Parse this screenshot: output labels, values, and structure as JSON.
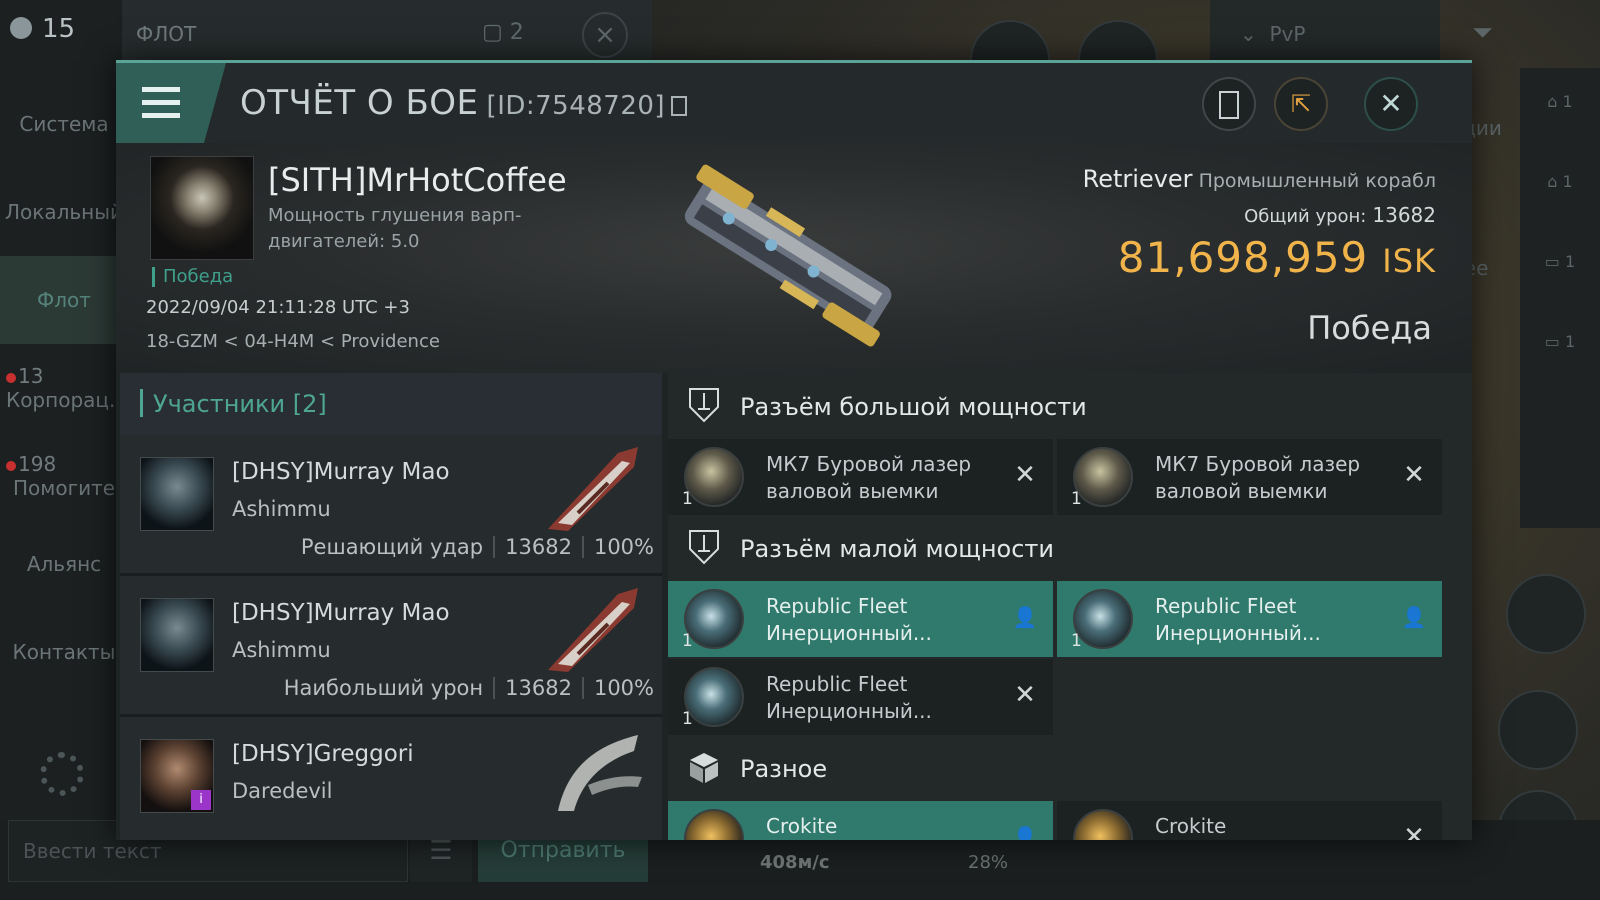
{
  "background": {
    "pilot_count": "15",
    "fleet_tab": "ФЛОТ",
    "fleet_count": "2",
    "pvp_label": "PvP",
    "side_nav": [
      {
        "label": "Система"
      },
      {
        "label": "Локальный"
      },
      {
        "label": "Флот"
      },
      {
        "label": "Корпорац..",
        "badge": "13"
      },
      {
        "label": "Помогите",
        "badge": "198"
      },
      {
        "label": "Альянс"
      },
      {
        "label": "Контакты"
      }
    ],
    "chat_placeholder": "Ввести текст",
    "send_label": "Отправить",
    "speed": "408м/с",
    "percent": "28%",
    "right_col": [
      "1",
      "1",
      "1",
      "1"
    ],
    "right_fragments": [
      "ации",
      "ffee"
    ]
  },
  "modal": {
    "title": "ОТЧЁТ О БОЕ",
    "report_id": "[ID:7548720]",
    "victim": {
      "name": "[SITH]MrHotCoffee",
      "warp_strength": "Мощность глушения варп-двигателей: 5.0",
      "status": "Победа",
      "datetime": "2022/09/04 21:11:28 UTC +3",
      "location": "18-GZM < 04-H4M < Providence"
    },
    "ship": {
      "name": "Retriever",
      "class": "Промышленный корабл",
      "total_damage_label": "Общий урон:",
      "total_damage": "13682",
      "isk_value": "81,698,959",
      "isk_currency": "ISK",
      "result": "Победа"
    },
    "participants": {
      "header": "Участники [2]",
      "rows": [
        {
          "name": "[DHSY]Murray Mao",
          "ship": "Ashimmu",
          "role": "Решающий удар",
          "damage": "13682",
          "percent": "100%"
        },
        {
          "name": "[DHSY]Murray Mao",
          "ship": "Ashimmu",
          "role": "Наибольший урон",
          "damage": "13682",
          "percent": "100%"
        },
        {
          "name": "[DHSY]Greggori",
          "ship": "Daredevil",
          "role": "",
          "damage": "",
          "percent": ""
        }
      ]
    },
    "fittings": {
      "high": {
        "title": "Разъём большой мощности",
        "items": [
          {
            "qty": "1",
            "name": "МК7 Буровой лазер валовой выемки",
            "state": "destroyed"
          },
          {
            "qty": "1",
            "name": "МК7 Буровой лазер валовой выемки",
            "state": "destroyed"
          }
        ]
      },
      "low": {
        "title": "Разъём малой мощности",
        "items": [
          {
            "qty": "1",
            "name": "Republic Fleet Инерционный...",
            "state": "dropped"
          },
          {
            "qty": "1",
            "name": "Republic Fleet Инерционный...",
            "state": "dropped"
          },
          {
            "qty": "1",
            "name": "Republic Fleet Инерционный...",
            "state": "destroyed"
          }
        ]
      },
      "misc": {
        "title": "Разное",
        "items": [
          {
            "qty": "",
            "name": "Crokite",
            "state": "dropped"
          },
          {
            "qty": "",
            "name": "Crokite",
            "state": "destroyed"
          }
        ]
      }
    }
  }
}
